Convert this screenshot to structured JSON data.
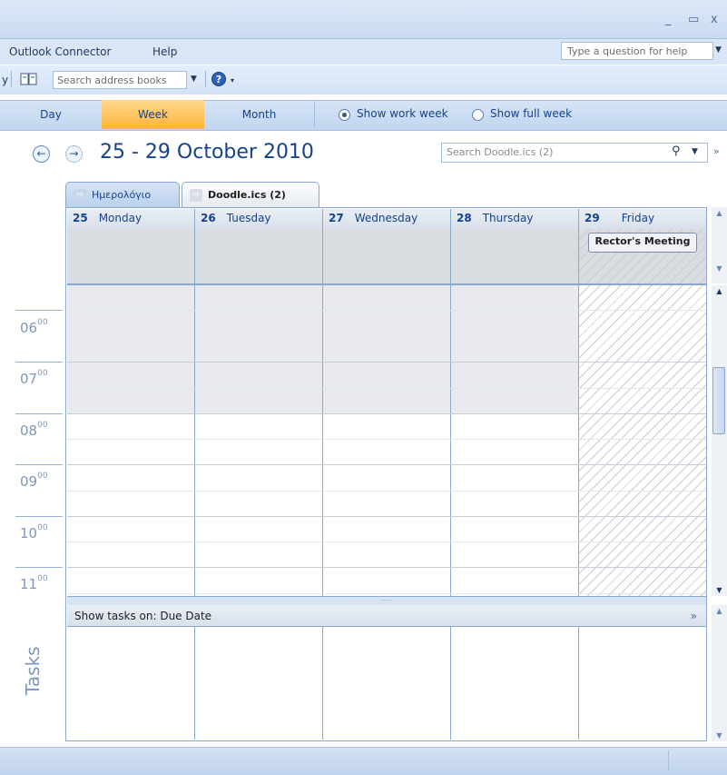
{
  "menubar": {
    "outlook_connector": "Outlook Connector",
    "help": "Help",
    "help_placeholder": "Type a question for help"
  },
  "toolbar": {
    "address_prefix": "y",
    "search_address_books": "Search address books"
  },
  "views": {
    "day": "Day",
    "week": "Week",
    "month": "Month",
    "show_work_week": "Show work week",
    "show_full_week": "Show full week"
  },
  "calendar": {
    "date_range": "25 - 29 October 2010",
    "search_placeholder": "Search Doodle.ics (2)",
    "tabs": [
      {
        "label": "Ημερολόγιο"
      },
      {
        "label": "Doodle.ics (2)"
      }
    ],
    "days": [
      {
        "num": "25",
        "name": "Monday"
      },
      {
        "num": "26",
        "name": "Tuesday"
      },
      {
        "num": "27",
        "name": "Wednesday"
      },
      {
        "num": "28",
        "name": "Thursday"
      },
      {
        "num": "29",
        "name": "Friday"
      }
    ],
    "event": "Rector's Meeting",
    "hours": [
      "06",
      "07",
      "08",
      "09",
      "10",
      "11"
    ],
    "minutes": "00"
  },
  "tasks": {
    "header": "Show tasks on: Due Date",
    "label": "Tasks"
  }
}
